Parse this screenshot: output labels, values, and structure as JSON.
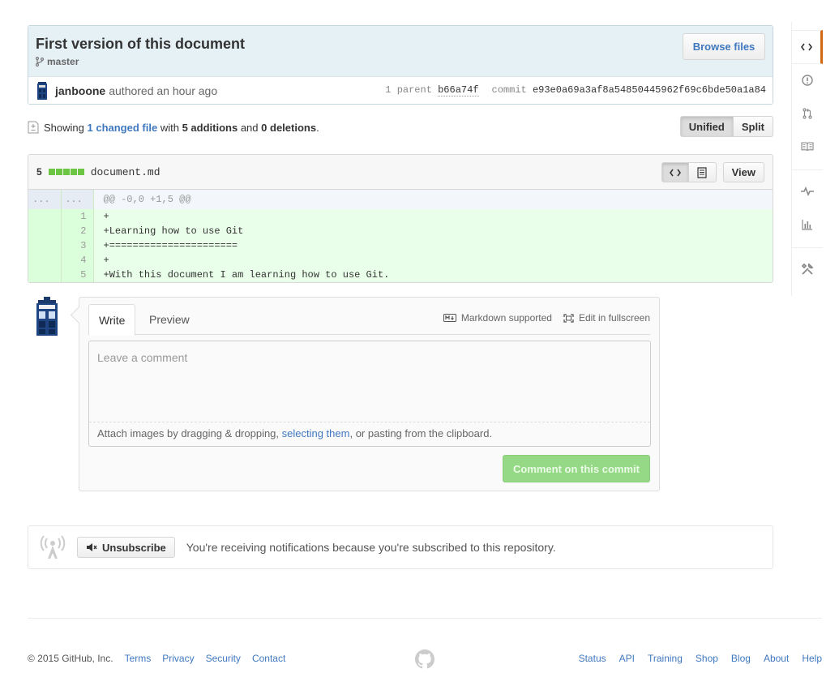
{
  "commit": {
    "title": "First version of this document",
    "branch": "master",
    "browse_label": "Browse files",
    "author": "janboone",
    "authored_text": "authored an hour ago",
    "parent_label": "1 parent",
    "parent_sha": "b66a74f",
    "commit_label": "commit",
    "commit_sha": "e93e0a69a3af8a54850445962f69c6bde50a1a84"
  },
  "toc": {
    "showing": "Showing",
    "changed_link": "1 changed file",
    "with": "with",
    "additions": "5 additions",
    "and": "and",
    "deletions": "0 deletions",
    "period": ".",
    "unified_label": "Unified",
    "split_label": "Split"
  },
  "file": {
    "diffstat": "5",
    "name": "document.md",
    "view_label": "View",
    "hunk_ellipsis": "...",
    "hunk_header": "@@ -0,0 +1,5 @@",
    "lines": [
      {
        "num": "1",
        "code": "+"
      },
      {
        "num": "2",
        "code": "+Learning how to use Git"
      },
      {
        "num": "3",
        "code": "+======================"
      },
      {
        "num": "4",
        "code": "+"
      },
      {
        "num": "5",
        "code": "+With this document I am learning how to use Git."
      }
    ]
  },
  "comment_form": {
    "write_tab": "Write",
    "preview_tab": "Preview",
    "markdown_label": "Markdown supported",
    "fullscreen_label": "Edit in fullscreen",
    "placeholder": "Leave a comment",
    "attach_prefix": "Attach images by dragging & dropping, ",
    "attach_link": "selecting them",
    "attach_suffix": ", or pasting from the clipboard.",
    "submit_label": "Comment on this commit"
  },
  "notifications": {
    "unsubscribe_label": "Unsubscribe",
    "message": "You're receiving notifications because you're subscribed to this repository."
  },
  "footer": {
    "copyright": "© 2015 GitHub, Inc.",
    "left_links": [
      "Terms",
      "Privacy",
      "Security",
      "Contact"
    ],
    "right_links": [
      "Status",
      "API",
      "Training",
      "Shop",
      "Blog",
      "About",
      "Help"
    ]
  },
  "colors": {
    "accent": "#4078c0",
    "addition_bg": "#eaffea",
    "nav_selected": "#d26911",
    "submit_disabled": "#95d886"
  }
}
